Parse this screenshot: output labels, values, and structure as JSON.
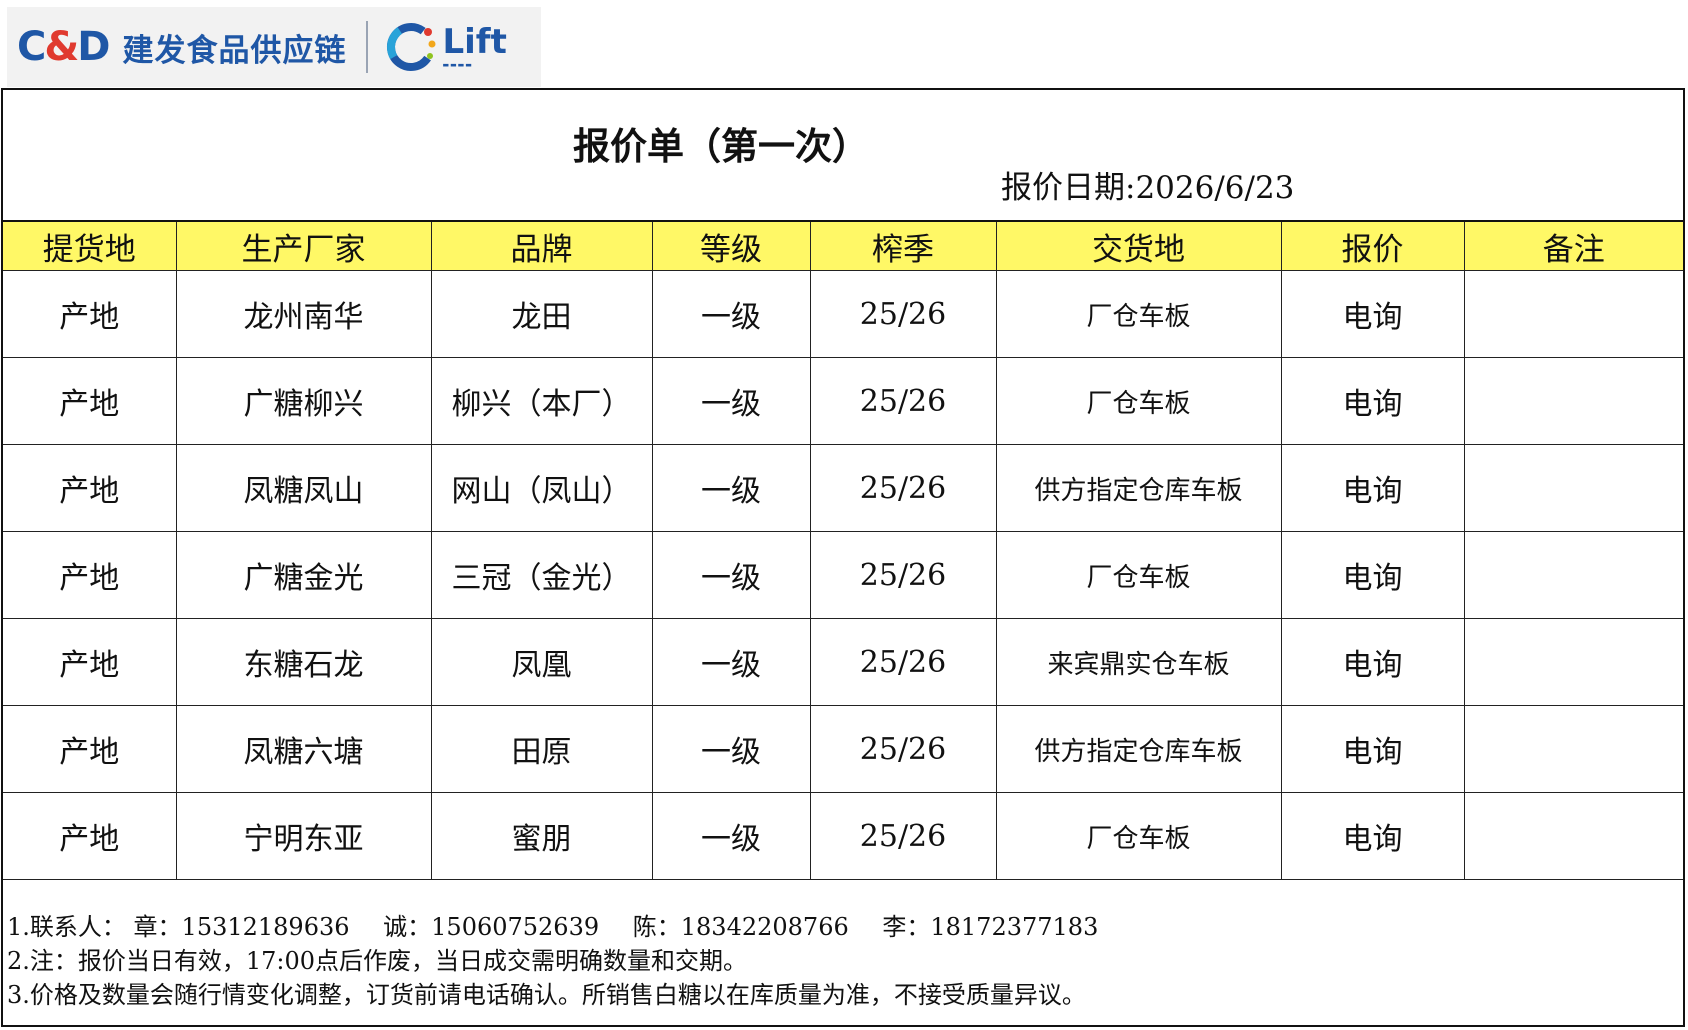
{
  "logo": {
    "cd_left": "C",
    "cd_amp": "&",
    "cd_right": "D",
    "company_name": "建发食品供应链",
    "lift_word": "Lift",
    "icon": "lift-ring-icon"
  },
  "header": {
    "title": "报价单（第一次）",
    "date_label": "报价日期:",
    "date_value": "2026/6/23"
  },
  "table": {
    "columns": [
      "提货地",
      "生产厂家",
      "品牌",
      "等级",
      "榨季",
      "交货地",
      "报价",
      "备注"
    ],
    "rows": [
      {
        "pickup": "产地",
        "maker": "龙州南华",
        "brand": "龙田",
        "grade": "一级",
        "season": "25/26",
        "delivery": "厂仓车板",
        "price": "电询",
        "remark": ""
      },
      {
        "pickup": "产地",
        "maker": "广糖柳兴",
        "brand": "柳兴（本厂）",
        "grade": "一级",
        "season": "25/26",
        "delivery": "厂仓车板",
        "price": "电询",
        "remark": ""
      },
      {
        "pickup": "产地",
        "maker": "凤糖凤山",
        "brand": "网山（凤山）",
        "grade": "一级",
        "season": "25/26",
        "delivery": "供方指定仓库车板",
        "price": "电询",
        "remark": ""
      },
      {
        "pickup": "产地",
        "maker": "广糖金光",
        "brand": "三冠（金光）",
        "grade": "一级",
        "season": "25/26",
        "delivery": "厂仓车板",
        "price": "电询",
        "remark": ""
      },
      {
        "pickup": "产地",
        "maker": "东糖石龙",
        "brand": "凤凰",
        "grade": "一级",
        "season": "25/26",
        "delivery": "来宾鼎实仓车板",
        "price": "电询",
        "remark": ""
      },
      {
        "pickup": "产地",
        "maker": "凤糖六塘",
        "brand": "田原",
        "grade": "一级",
        "season": "25/26",
        "delivery": "供方指定仓库车板",
        "price": "电询",
        "remark": ""
      },
      {
        "pickup": "产地",
        "maker": "宁明东亚",
        "brand": "蜜朋",
        "grade": "一级",
        "season": "25/26",
        "delivery": "厂仓车板",
        "price": "电询",
        "remark": ""
      }
    ]
  },
  "notes": {
    "contact_prefix": "1.联系人：",
    "contacts": [
      "章：15312189636",
      "诚：15060752639",
      "陈：18342208766",
      "李：18172377183"
    ],
    "note2": "2.注：报价当日有效，17:00点后作废，当日成交需明确数量和交期。",
    "note3": "3.价格及数量会随行情变化调整，订货前请电话确认。所销售白糖以在库质量为准，不接受质量异议。"
  },
  "colors": {
    "header_fill": "#fff866",
    "brand_blue": "#1f57a6",
    "brand_red": "#e03a2f"
  }
}
